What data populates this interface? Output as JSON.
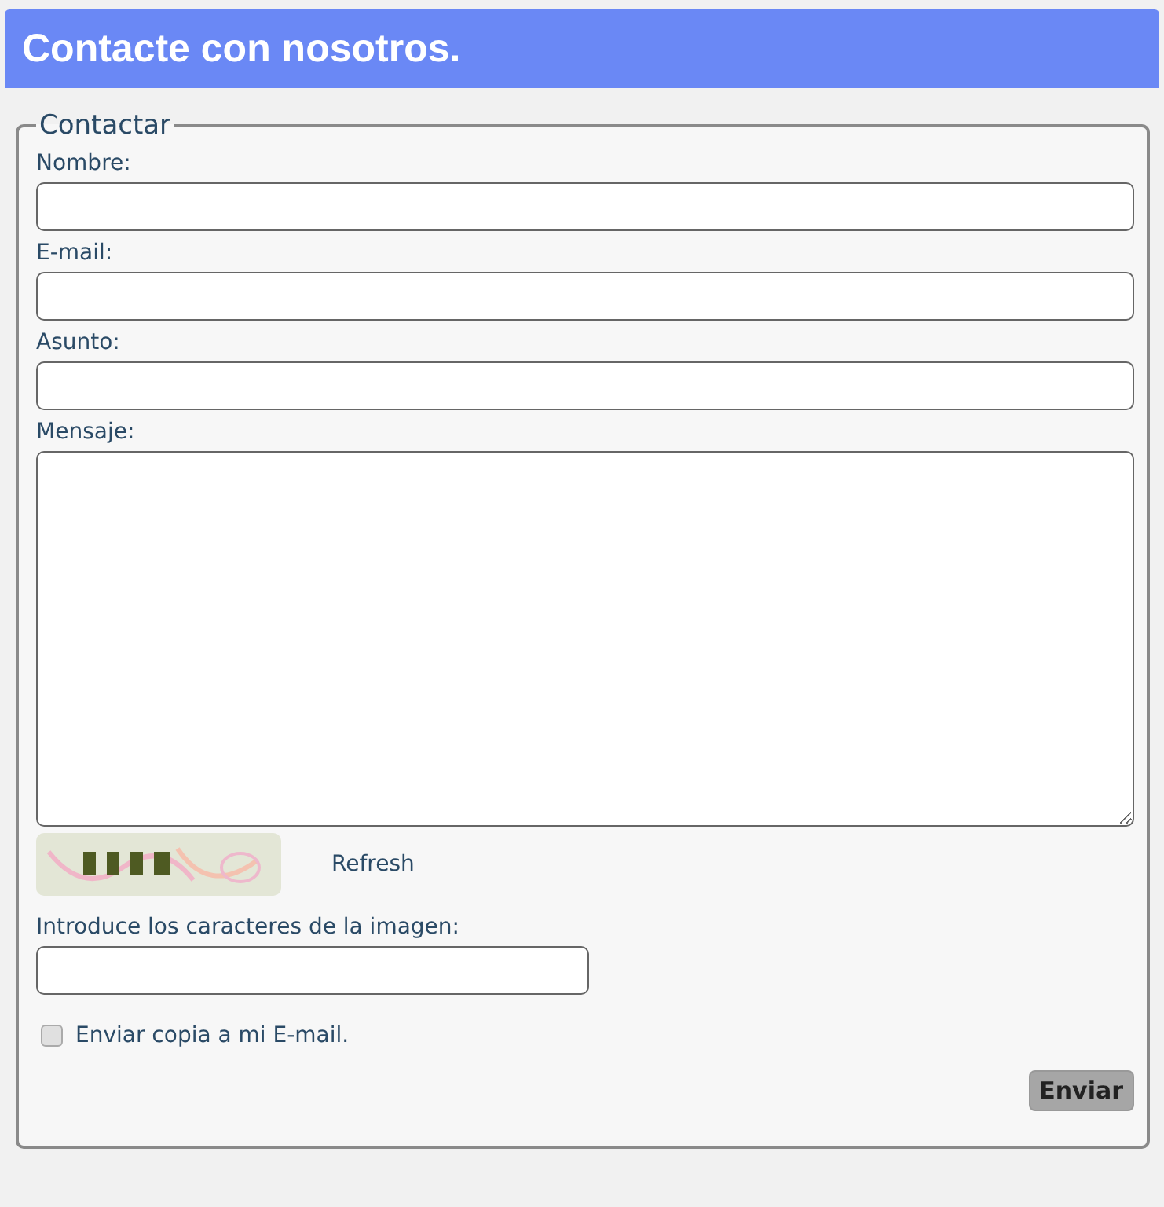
{
  "header": {
    "title": "Contacte con nosotros."
  },
  "form": {
    "legend": "Contactar",
    "fields": [
      {
        "kind": "input",
        "label": "Nombre:"
      },
      {
        "kind": "input",
        "label": "E-mail:"
      },
      {
        "kind": "input",
        "label": "Asunto:"
      },
      {
        "kind": "textarea",
        "label": "Mensaje:"
      }
    ],
    "captcha": {
      "kind": "picture",
      "refresh": "Refresh",
      "label": "Introduce los caracteres de la imagen:"
    },
    "copy": {
      "label": "Enviar copia a mi E-mail.",
      "checked": false
    },
    "submit": "Enviar"
  }
}
